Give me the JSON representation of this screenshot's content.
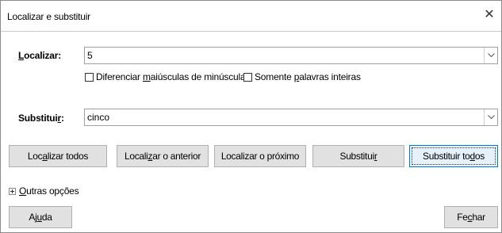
{
  "window": {
    "title": "Localizar e substituir",
    "close_glyph": "✕"
  },
  "find": {
    "label_pre": "",
    "label_accel": "L",
    "label_post": "ocalizar:",
    "value": "5"
  },
  "options": {
    "match_case": {
      "pre": "Diferenciar ",
      "accel": "m",
      "post": "aiúsculas de minúsculas",
      "checked": false
    },
    "whole_words": {
      "pre": "Somente ",
      "accel": "p",
      "post": "alavras inteiras",
      "checked": false
    }
  },
  "replace": {
    "label_pre": "Substitui",
    "label_accel": "r",
    "label_post": ":",
    "value": "cinco"
  },
  "buttons": {
    "find_all": {
      "pre": "Loc",
      "accel": "a",
      "post": "lizar todos"
    },
    "find_previous": {
      "pre": "Locali",
      "accel": "z",
      "post": "ar o anterior"
    },
    "find_next": {
      "pre": "Localizar o próximo",
      "accel": "",
      "post": ""
    },
    "replace": {
      "pre": "Substitui",
      "accel": "r",
      "post": ""
    },
    "replace_all": {
      "pre": "Substituir to",
      "accel": "d",
      "post": "os"
    },
    "help": {
      "pre": "Aj",
      "accel": "u",
      "post": "da"
    },
    "close": {
      "pre": "Fe",
      "accel": "c",
      "post": "har"
    }
  },
  "more_options": {
    "pre": "",
    "accel": "O",
    "post": "utras opções"
  }
}
